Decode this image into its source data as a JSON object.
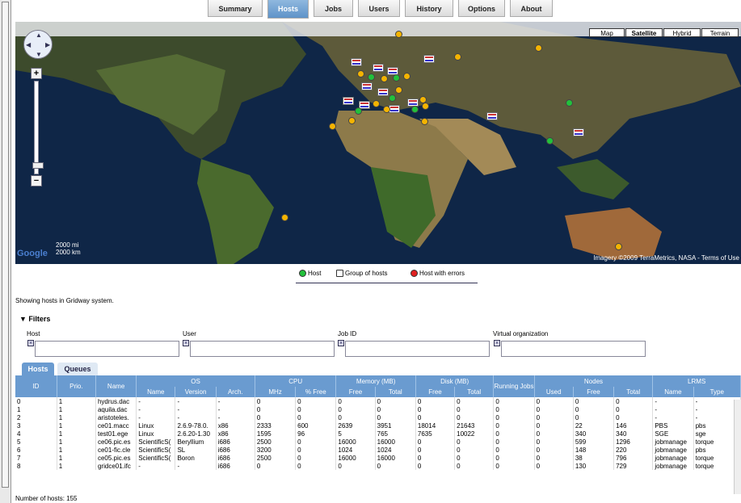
{
  "tabs": [
    "Summary",
    "Hosts",
    "Jobs",
    "Users",
    "History",
    "Options",
    "About"
  ],
  "active_tab": "Hosts",
  "map": {
    "types": [
      "Map",
      "Satellite",
      "Hybrid",
      "Terrain"
    ],
    "selected_type": "Satellite",
    "scale_mi": "2000 mi",
    "scale_km": "2000 km",
    "logo": "Google",
    "attribution": "Imagery ©2009 TerraMetrics, NASA - Terms of Use"
  },
  "legend": {
    "host": "Host",
    "group": "Group of hosts",
    "error": "Host with errors"
  },
  "showing_text": "Showing hosts in Gridway system.",
  "filters": {
    "title": "Filters",
    "labels": {
      "host": "Host",
      "user": "User",
      "job_id": "Job ID",
      "vo": "Virtual organization"
    },
    "values": {
      "host": "",
      "user": "",
      "job_id": "",
      "vo": ""
    }
  },
  "subtabs": [
    "Hosts",
    "Queues"
  ],
  "table": {
    "groups": [
      "ID",
      "Prio.",
      "Name",
      "OS",
      "CPU",
      "Memory (MB)",
      "Disk (MB)",
      "Running Jobs",
      "Nodes",
      "LRMS"
    ],
    "subheaders": [
      "",
      "",
      "",
      "Name",
      "Version",
      "Arch.",
      "MHz",
      "% Free",
      "Free",
      "Total",
      "Free",
      "Total",
      "",
      "Used",
      "Free",
      "Total",
      "Name",
      "Type"
    ],
    "rows": [
      [
        "0",
        "1",
        "hydrus.dac",
        "-",
        "-",
        "-",
        "0",
        "0",
        "0",
        "0",
        "0",
        "0",
        "0",
        "0",
        "0",
        "0",
        "-",
        "-"
      ],
      [
        "1",
        "1",
        "aquila.dac",
        "-",
        "-",
        "-",
        "0",
        "0",
        "0",
        "0",
        "0",
        "0",
        "0",
        "0",
        "0",
        "0",
        "-",
        "-"
      ],
      [
        "2",
        "1",
        "aristoteles.",
        "-",
        "-",
        "-",
        "0",
        "0",
        "0",
        "0",
        "0",
        "0",
        "0",
        "0",
        "0",
        "0",
        "-",
        "-"
      ],
      [
        "3",
        "1",
        "ce01.macc",
        "Linux",
        "2.6.9-78.0.",
        "x86",
        "2333",
        "600",
        "2639",
        "3951",
        "18014",
        "21643",
        "0",
        "0",
        "22",
        "146",
        "PBS",
        "pbs"
      ],
      [
        "4",
        "1",
        "test01.ege",
        "Linux",
        "2.6.20-1.30",
        "x86",
        "1595",
        "96",
        "5",
        "765",
        "7635",
        "10022",
        "0",
        "0",
        "340",
        "340",
        "SGE",
        "sge"
      ],
      [
        "5",
        "1",
        "ce06.pic.es",
        "ScientificS(",
        "Beryllium",
        "i686",
        "2500",
        "0",
        "16000",
        "16000",
        "0",
        "0",
        "0",
        "0",
        "599",
        "1296",
        "jobmanage",
        "torque"
      ],
      [
        "6",
        "1",
        "ce01-fic.cle",
        "ScientificS(",
        "SL",
        "i686",
        "3200",
        "0",
        "1024",
        "1024",
        "0",
        "0",
        "0",
        "0",
        "148",
        "220",
        "jobmanage",
        "pbs"
      ],
      [
        "7",
        "1",
        "ce05.pic.es",
        "ScientificS(",
        "Boron",
        "i686",
        "2500",
        "0",
        "16000",
        "16000",
        "0",
        "0",
        "0",
        "0",
        "38",
        "796",
        "jobmanage",
        "torque"
      ],
      [
        "8",
        "1",
        "gridce01.ifc",
        "-",
        "-",
        "i686",
        "0",
        "0",
        "0",
        "0",
        "0",
        "0",
        "0",
        "0",
        "130",
        "729",
        "jobmanage",
        "torque"
      ]
    ]
  },
  "hosts_count_label": "Number of hosts: 155"
}
